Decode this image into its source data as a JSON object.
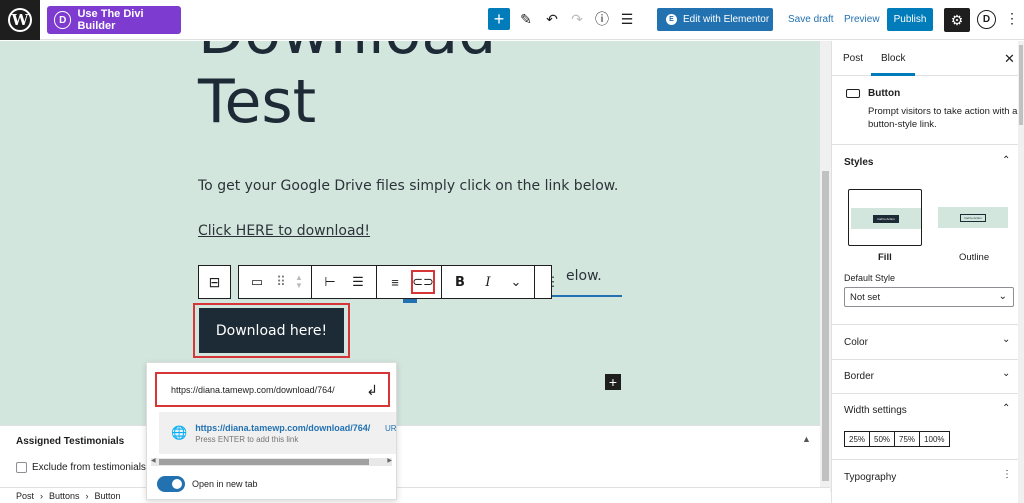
{
  "topbar": {
    "wp_logo_letter": "W",
    "divi_letter": "D",
    "divi_label": "Use The Divi Builder",
    "add_block_icon": "plus-icon",
    "tools_icon": "pencil-icon",
    "undo_icon": "undo-icon",
    "redo_icon": "redo-icon",
    "details_icon": "info-icon",
    "outline_icon": "list-view-icon",
    "elementor_letter": "E",
    "elementor_label": "Edit with Elementor",
    "save_draft_label": "Save draft",
    "preview_label": "Preview",
    "publish_label": "Publish",
    "settings_icon": "gear-icon",
    "divi_account_letter": "D",
    "more_icon": "kebab-icon"
  },
  "editor": {
    "title_line1": "Download",
    "title_line2": "Test",
    "paragraph1": "To get your Google Drive files simply click on the link below.",
    "paragraph2_link": "Click HERE to download!",
    "paragraph3_fragment": "elow.",
    "button_text": "Download here!"
  },
  "block_toolbar": {
    "parent_icon": "buttons-parent-icon",
    "block_icon": "button-icon",
    "drag_icon": "drag-handle-icon",
    "move_up_icon": "chevron-up-icon",
    "move_down_icon": "chevron-down-icon",
    "align_left_icon": "justify-left-icon",
    "align_center_icon": "justify-center-icon",
    "vertical_align_icon": "align-icon",
    "link_icon": "link-icon",
    "bold_label": "B",
    "italic_label": "I",
    "more_formats_icon": "chevron-down-icon",
    "options_icon": "kebab-icon"
  },
  "link_popover": {
    "url_value": "https://diana.tamewp.com/download/764/",
    "submit_icon": "enter-icon",
    "suggestion_url": "https://diana.tamewp.com/download/764/",
    "suggestion_hint": "Press ENTER to add this link",
    "suggestion_type": "URL",
    "suggestion_icon": "globe-icon",
    "new_tab_label": "Open in new tab",
    "new_tab_enabled": true
  },
  "meta_box": {
    "title": "Assigned Testimonials",
    "checkbox_label": "Exclude from testimonials"
  },
  "breadcrumb": [
    "Post",
    "Buttons",
    "Button"
  ],
  "sidebar": {
    "tab_post": "Post",
    "tab_block": "Block",
    "block_name": "Button",
    "block_description": "Prompt visitors to take action with a button-style link.",
    "styles_title": "Styles",
    "style_fill": "Fill",
    "style_outline": "Outline",
    "default_style_label": "Default Style",
    "default_style_value": "Not set",
    "color_title": "Color",
    "border_title": "Border",
    "width_title": "Width settings",
    "width_options": [
      "25%",
      "50%",
      "75%",
      "100%"
    ],
    "typography_title": "Typography"
  },
  "colors": {
    "canvas_bg": "#d3e6de",
    "primary": "#007cba",
    "highlight": "#d63638",
    "button_bg": "#1d2b36",
    "divi_purple": "#7e3bd0"
  }
}
